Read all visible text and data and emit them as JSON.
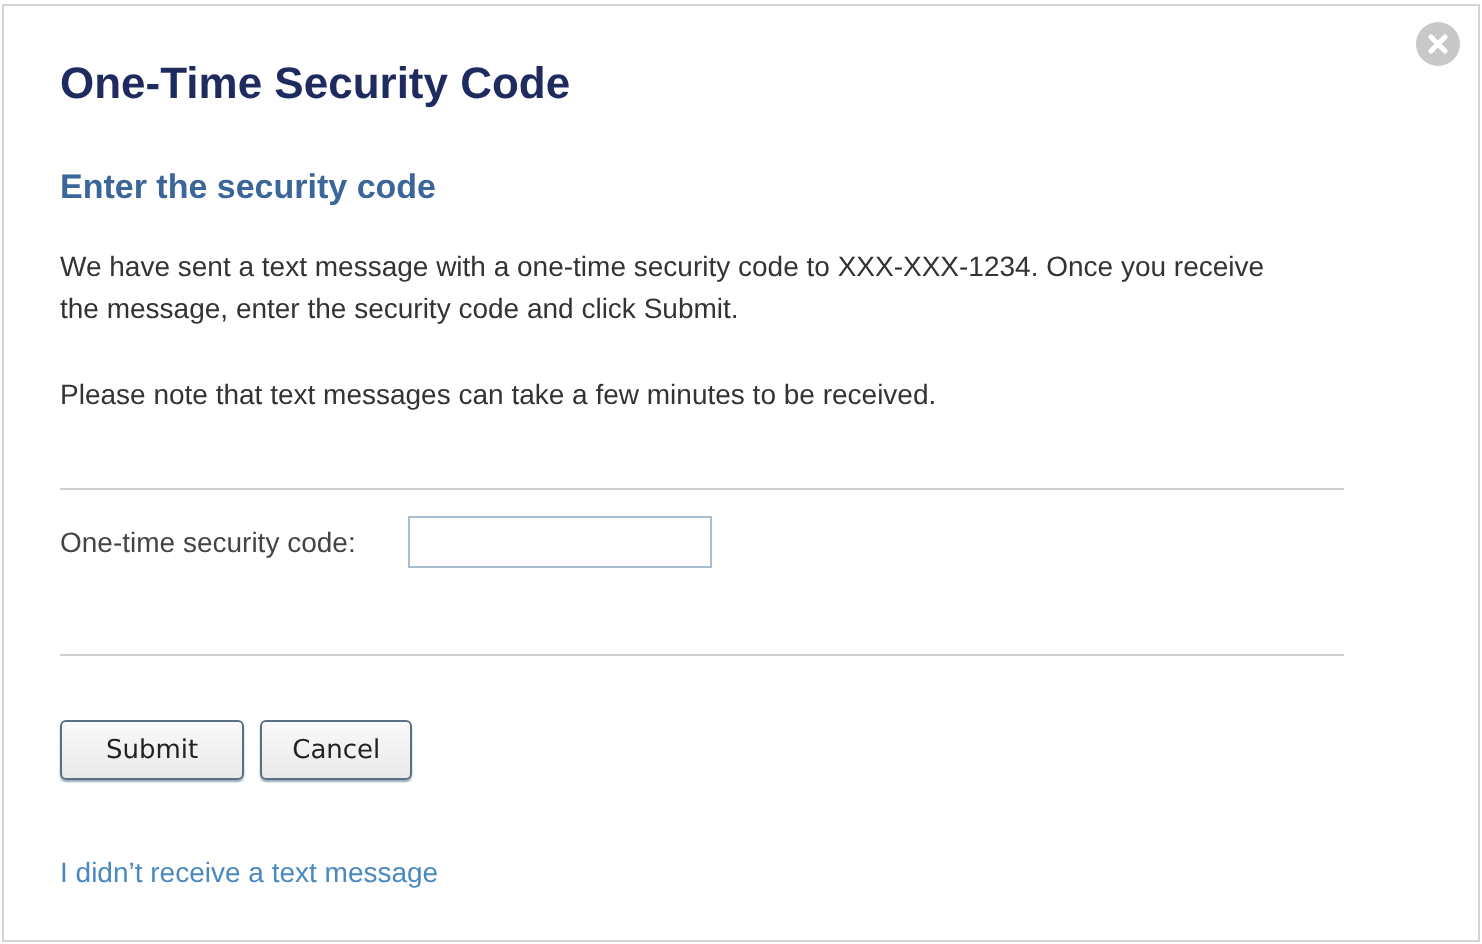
{
  "dialog": {
    "title": "One-Time Security Code",
    "subtitle": "Enter the security code",
    "paragraphs": [
      "We have sent a text message with a one-time security code to XXX-XXX-1234. Once you receive the message, enter the security code and click Submit.",
      "Please note that text messages can take a few minutes to be received."
    ],
    "field": {
      "label": "One-time security code:"
    },
    "buttons": [
      "Submit",
      "Cancel"
    ],
    "link": "I didn’t receive a text message"
  }
}
